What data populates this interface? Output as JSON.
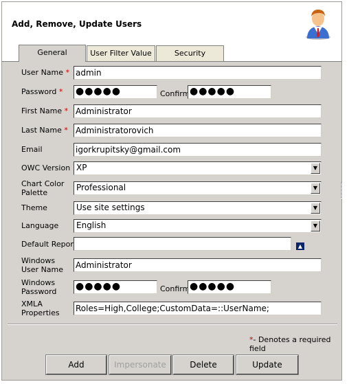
{
  "header": {
    "title": "Add, Remove, Update Users",
    "icon": "user-avatar-icon"
  },
  "tabs": [
    {
      "label": "General"
    },
    {
      "label": "User Filter Value"
    },
    {
      "label": "Security"
    }
  ],
  "form": {
    "username": {
      "label": "User Name",
      "required": "*",
      "value": "admin"
    },
    "password": {
      "label": "Password",
      "required": "*",
      "value": "●●●●●"
    },
    "confirm_password": {
      "label": "Confirm",
      "value": "●●●●●"
    },
    "first_name": {
      "label": "First Name",
      "required": "*",
      "value": "Administrator"
    },
    "last_name": {
      "label": "Last Name",
      "required": "*",
      "value": "Administratorovich"
    },
    "email": {
      "label": "Email",
      "value": "igorkrupitsky@gmail.com"
    },
    "owc_version": {
      "label": "OWC Version",
      "value": "XP"
    },
    "chart_color_palette": {
      "label_line1": "Chart Color",
      "label_line2": "Palette",
      "value": "Professional"
    },
    "theme": {
      "label": "Theme",
      "value": "Use site settings"
    },
    "language": {
      "label": "Language",
      "value": "English"
    },
    "default_report": {
      "label": "Default Report",
      "value": ""
    },
    "windows_user_name": {
      "label_line1": "Windows",
      "label_line2": "User Name",
      "value": "Administrator"
    },
    "windows_password": {
      "label_line1": "Windows",
      "label_line2": "Password",
      "value": "●●●●●"
    },
    "windows_confirm": {
      "label": "Confirm",
      "value": "●●●●●"
    },
    "xmla_properties": {
      "label_line1": "XMLA",
      "label_line2": "Properties",
      "value": "Roles=High,College;CustomData=::UserName;"
    }
  },
  "required_note": {
    "star": "*",
    "text": "- Denotes a required field"
  },
  "buttons": {
    "add": "Add",
    "impersonate": "Impersonate",
    "delete": "Delete",
    "update": "Update"
  }
}
